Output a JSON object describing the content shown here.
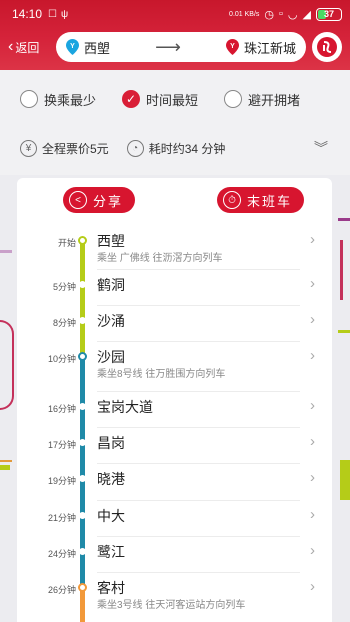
{
  "status_bar": {
    "time": "14:10",
    "network_speed": "0.01 KB/s",
    "battery": "37"
  },
  "nav": {
    "back_label": "返回",
    "from_station": "西塱",
    "to_station": "珠江新城"
  },
  "options": [
    {
      "label": "换乘最少",
      "selected": false
    },
    {
      "label": "时间最短",
      "selected": true
    },
    {
      "label": "避开拥堵",
      "selected": false
    }
  ],
  "summary": {
    "fare": "全程票价5元",
    "duration": "耗时约34 分钟"
  },
  "actions": {
    "share_label": "分享",
    "last_train_label": "末班车"
  },
  "colors": {
    "brand": "#d7152f",
    "line1": "#b5cc18",
    "line8": "#1f8aa8",
    "line3": "#f2993a"
  },
  "stops": [
    {
      "time": "开始",
      "name": "西塱",
      "sub": "乘坐 广佛线 往沥滘方向列车"
    },
    {
      "time": "5分钟",
      "name": "鹤洞",
      "sub": ""
    },
    {
      "time": "8分钟",
      "name": "沙涌",
      "sub": ""
    },
    {
      "time": "10分钟",
      "name": "沙园",
      "sub": "乘坐8号线 往万胜围方向列车"
    },
    {
      "time": "16分钟",
      "name": "宝岗大道",
      "sub": ""
    },
    {
      "time": "17分钟",
      "name": "昌岗",
      "sub": ""
    },
    {
      "time": "19分钟",
      "name": "晓港",
      "sub": ""
    },
    {
      "time": "21分钟",
      "name": "中大",
      "sub": ""
    },
    {
      "time": "24分钟",
      "name": "鹭江",
      "sub": ""
    },
    {
      "time": "26分钟",
      "name": "客村",
      "sub": "乘坐3号线 往天河客运站方向列车"
    }
  ]
}
